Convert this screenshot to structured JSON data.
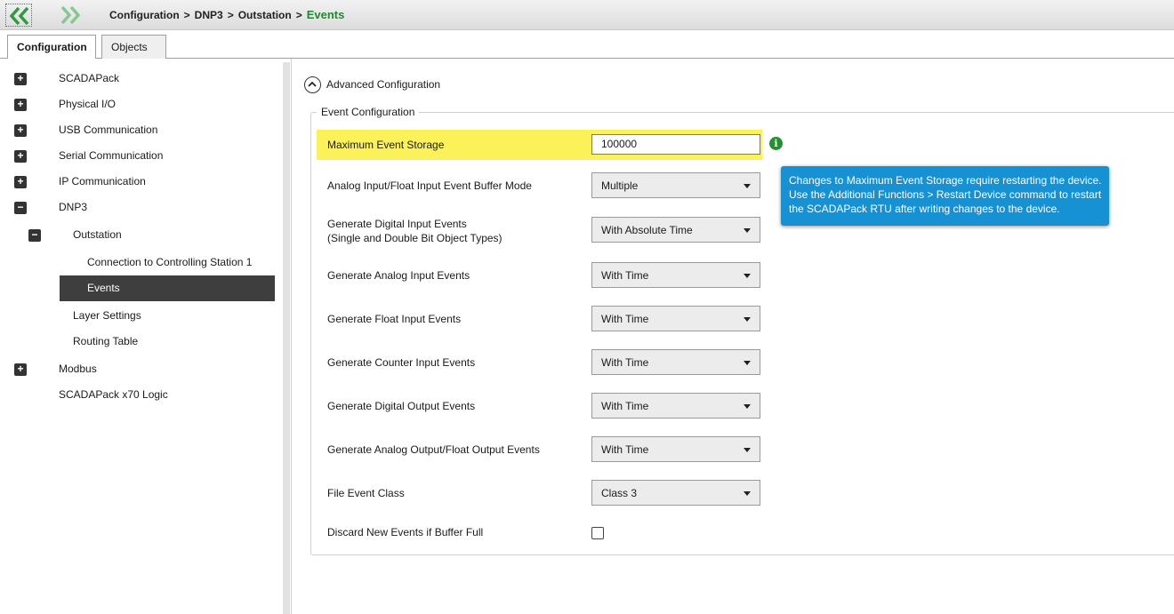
{
  "breadcrumb": {
    "items": [
      "Configuration",
      "DNP3",
      "Outstation"
    ],
    "separator": ">",
    "current": "Events",
    "current_color": "#1f8a2d"
  },
  "nav": {
    "back_icon": "double-chevron-left-icon",
    "forward_icon": "double-chevron-right-icon",
    "accent": "#2e9b3e"
  },
  "tabs": [
    {
      "label": "Configuration",
      "active": true
    },
    {
      "label": "Objects",
      "active": false
    }
  ],
  "sidebar": {
    "items": [
      {
        "label": "SCADAPack",
        "toggle": "+"
      },
      {
        "label": "Physical I/O",
        "toggle": "+"
      },
      {
        "label": "USB Communication",
        "toggle": "+"
      },
      {
        "label": "Serial Communication",
        "toggle": "+"
      },
      {
        "label": "IP Communication",
        "toggle": "+"
      },
      {
        "label": "DNP3",
        "toggle": "−"
      },
      {
        "label": "Outstation",
        "toggle": "−"
      },
      {
        "label": "Connection to Controlling Station 1"
      },
      {
        "label": "Events",
        "selected": true
      },
      {
        "label": "Layer Settings"
      },
      {
        "label": "Routing Table"
      },
      {
        "label": "Modbus",
        "toggle": "+"
      },
      {
        "label": "SCADAPack x70 Logic"
      }
    ]
  },
  "main": {
    "advanced_label": "Advanced Configuration",
    "group_title": "Event Configuration",
    "max_storage": {
      "label": "Maximum Event Storage",
      "value": "100000"
    },
    "rows": [
      {
        "label": "Analog Input/Float Input Event Buffer Mode",
        "value": "Multiple"
      },
      {
        "label": "Generate Digital Input Events",
        "label2": "(Single and Double Bit Object Types)",
        "value": "With Absolute Time"
      },
      {
        "label": "Generate Analog Input Events",
        "value": "With Time"
      },
      {
        "label": "Generate Float Input Events",
        "value": "With Time"
      },
      {
        "label": "Generate Counter Input Events",
        "value": "With Time"
      },
      {
        "label": "Generate Digital Output Events",
        "value": "With Time"
      },
      {
        "label": "Generate Analog Output/Float Output Events",
        "value": "With Time"
      },
      {
        "label": "File Event Class",
        "value": "Class 3"
      }
    ],
    "discard": {
      "label": "Discard New Events if Buffer Full",
      "checked": false
    },
    "tooltip": [
      "Changes to Maximum Event Storage require restarting the device.",
      "Use the Additional Functions > Restart Device command to restart",
      "the SCADAPack RTU after writing changes to the device."
    ],
    "highlight_color": "#fbf25a",
    "tooltip_color": "#1691d4",
    "info_icon": "info-icon"
  }
}
